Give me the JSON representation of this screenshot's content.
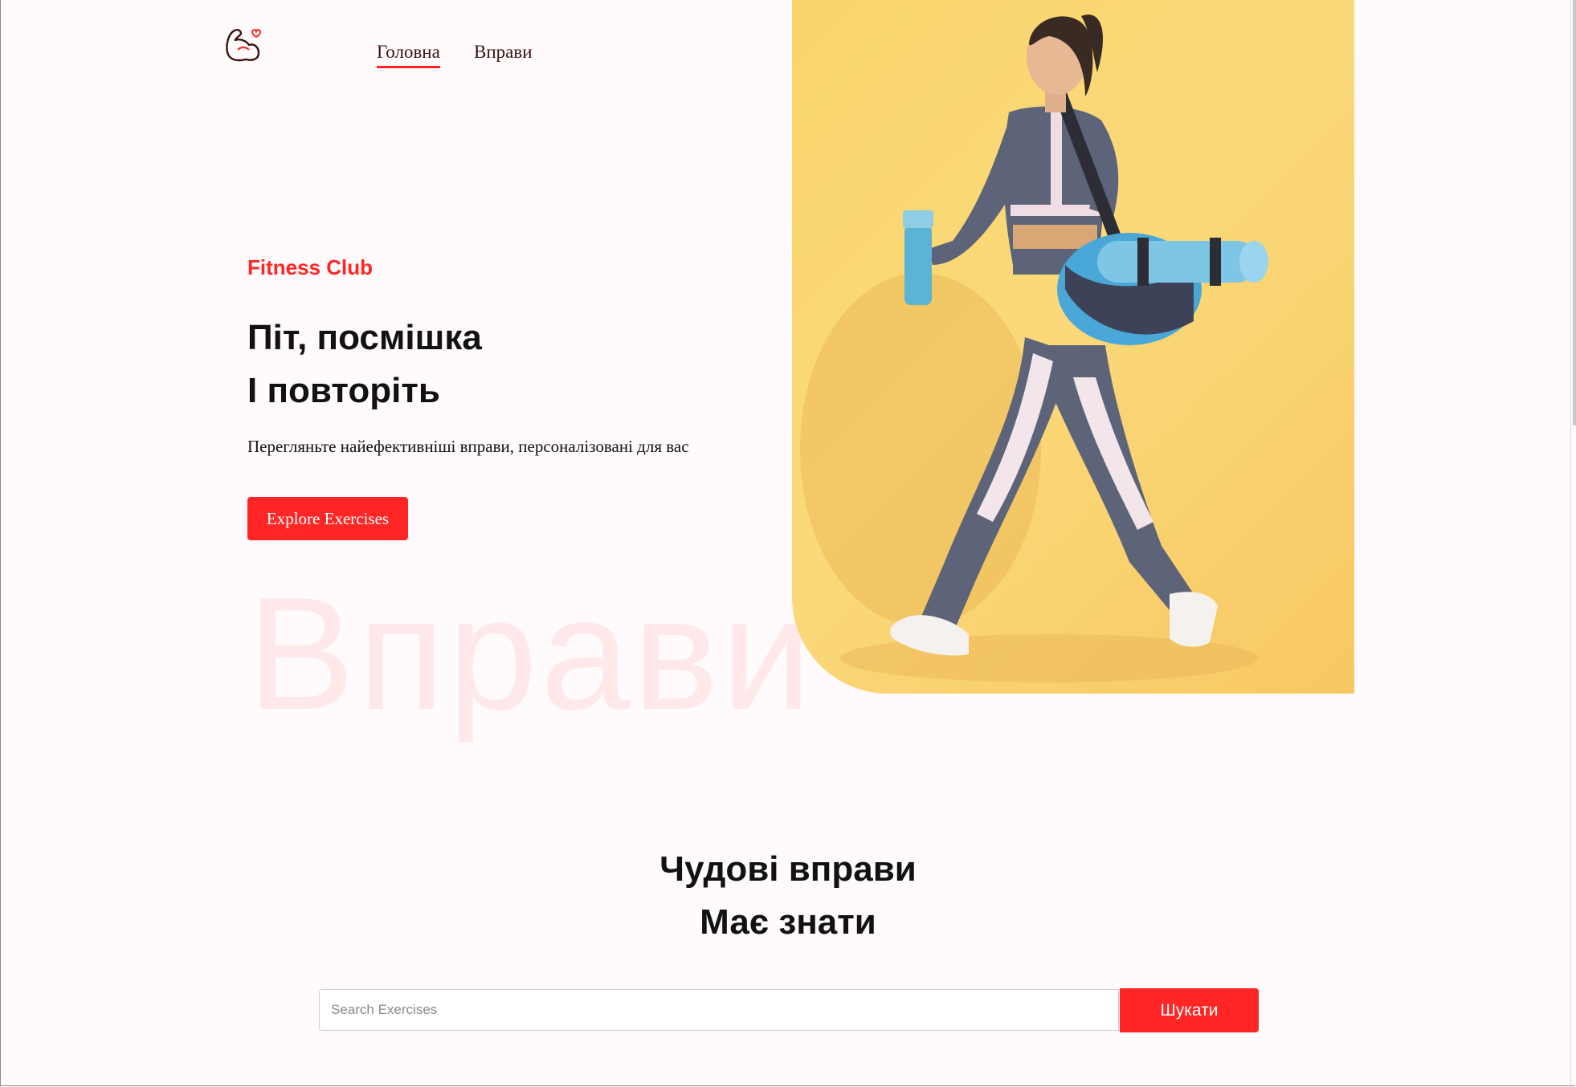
{
  "nav": {
    "logo_icon": "flexed-bicep-heart-icon",
    "home_label": "Головна",
    "exercises_label": "Вправи"
  },
  "hero": {
    "eyebrow": "Fitness Club",
    "headline_line1": "Піт, посмішка",
    "headline_line2": "І повторіть",
    "subtitle": "Перегляньте найефективніші вправи, персоналізовані для вас",
    "cta_label": "Explore Exercises",
    "watermark": "Вправи",
    "image_subject": "woman-walking-with-yoga-mat-and-bottle"
  },
  "search_section": {
    "title_line1": "Чудові вправи",
    "title_line2": "Має знати",
    "placeholder": "Search Exercises",
    "value": "",
    "button_label": "Шукати"
  },
  "colors": {
    "accent": "#ff2625",
    "background": "#fffafb",
    "hero_image_bg": "#f8d56a"
  }
}
